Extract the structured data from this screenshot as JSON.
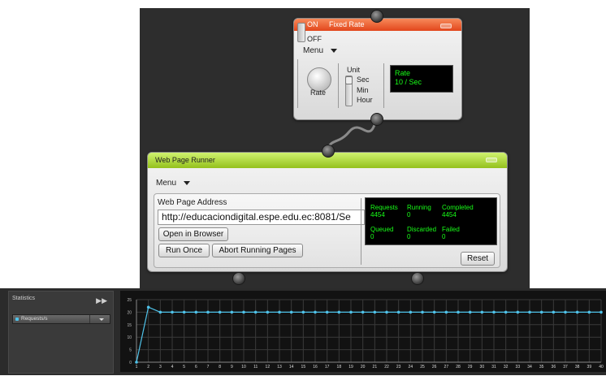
{
  "fixed_rate": {
    "on_label": "ON",
    "off_label": "OFF",
    "title": "Fixed Rate",
    "menu_label": "Menu",
    "knob_label": "Rate",
    "unit_label": "Unit",
    "units": [
      "Sec",
      "Min",
      "Hour"
    ],
    "display_line1": "Rate",
    "display_line2": "10 / Sec"
  },
  "runner": {
    "title": "Web Page Runner",
    "menu_label": "Menu",
    "address_label": "Web Page Address",
    "address_value": "http://educaciondigital.espe.edu.ec:8081/Se",
    "open_browser": "Open in Browser",
    "run_once": "Run Once",
    "abort": "Abort Running Pages",
    "reset": "Reset",
    "stats": {
      "requests_label": "Requests",
      "requests_value": "4454",
      "running_label": "Running",
      "running_value": "0",
      "completed_label": "Completed",
      "completed_value": "4454",
      "queued_label": "Queued",
      "queued_value": "0",
      "discarded_label": "Discarded",
      "discarded_value": "0",
      "failed_label": "Failed",
      "failed_value": "0"
    }
  },
  "statistics": {
    "title": "Statistics",
    "series_select": "Requests/s"
  },
  "colors": {
    "series": "#4fc3ea",
    "fixed_rate_header": "#e8542a",
    "runner_header": "#a8d52c",
    "display_text": "#18ff18"
  },
  "chart_data": {
    "type": "line",
    "x": [
      1,
      2,
      3,
      4,
      5,
      6,
      7,
      8,
      9,
      10,
      11,
      12,
      13,
      14,
      15,
      16,
      17,
      18,
      19,
      20,
      21,
      22,
      23,
      24,
      25,
      26,
      27,
      28,
      29,
      30,
      31,
      32,
      33,
      34,
      35,
      36,
      37,
      38,
      39,
      40
    ],
    "series": [
      {
        "values": [
          0,
          22,
          20,
          20,
          20,
          20,
          20,
          20,
          20,
          20,
          20,
          20,
          20,
          20,
          20,
          20,
          20,
          20,
          20,
          20,
          20,
          20,
          20,
          20,
          20,
          20,
          20,
          20,
          20,
          20,
          20,
          20,
          20,
          20,
          20,
          20,
          20,
          20,
          20,
          20
        ]
      }
    ],
    "y_ticks": [
      0,
      5,
      10,
      15,
      20,
      25
    ],
    "ylim": [
      0,
      25
    ],
    "grid": true
  }
}
